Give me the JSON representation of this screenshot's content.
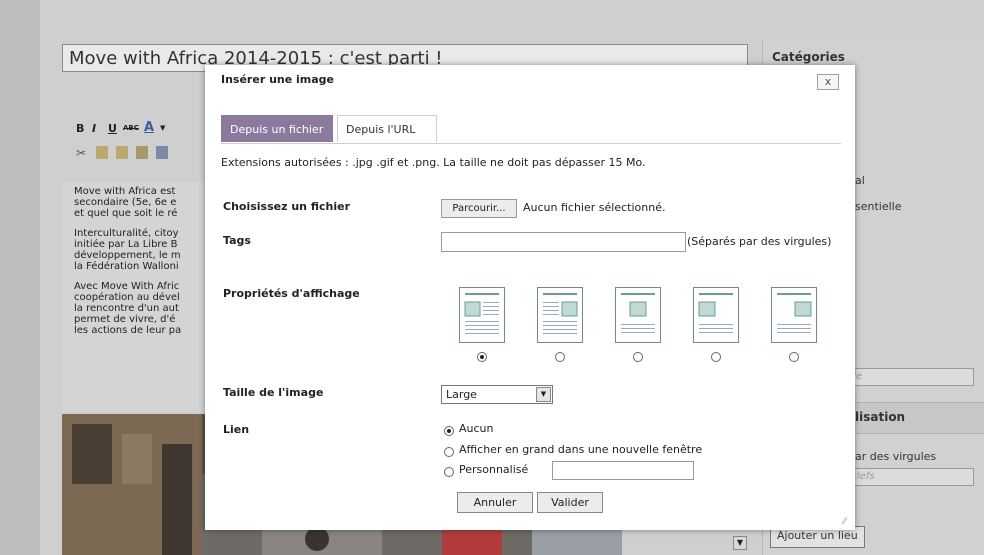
{
  "background": {
    "post_title": "Move with Africa 2014-2015 : c'est parti !",
    "toolbar": {
      "bold": "B",
      "italic": "I",
      "underline": "U",
      "strike": "ABC",
      "font_color": "A"
    },
    "editor_paragraphs": [
      [
        "Move with Africa est",
        "secondaire (5e, 6e e",
        "et quel que soit le ré"
      ],
      [
        "Interculturalité, citoy",
        "initiée par La Libre B",
        "développement, le m",
        "la Fédération Walloni"
      ],
      [
        "Avec Move With Afric",
        "coopération au dével",
        "la rencontre d'un aut",
        "permet de vivre, d'é",
        "les actions de leur pa"
      ]
    ],
    "sidebar": {
      "categories_title": "Catégories",
      "item_1": "al",
      "item_2": "sentielle",
      "new_category_placeholder": "orie",
      "section_2_title": "lisation",
      "tags_hint": "ar des virgules",
      "tags_placeholder": "s clefs",
      "add_place_button": "Ajouter un lieu"
    }
  },
  "dialog": {
    "title": "Insérer une image",
    "close_label": "x",
    "tabs": [
      {
        "label": "Depuis un fichier",
        "active": true
      },
      {
        "label": "Depuis l'URL",
        "active": false
      }
    ],
    "extensions_text": "Extensions autorisées : .jpg .gif et .png. La taille ne doit pas dépasser 15 Mo.",
    "file": {
      "label": "Choisissez un fichier",
      "browse_label": "Parcourir...",
      "status": "Aucun fichier sélectionné."
    },
    "tags": {
      "label": "Tags",
      "value": "",
      "hint": "(Séparés par des virgules)"
    },
    "display": {
      "label": "Propriétés d'affichage",
      "selected_index": 0,
      "options": [
        "left-text-wrap",
        "right-text-wrap",
        "center",
        "left",
        "right"
      ]
    },
    "size": {
      "label": "Taille de l'image",
      "selected": "Large"
    },
    "link": {
      "label": "Lien",
      "options": [
        "Aucun",
        "Afficher en grand dans une nouvelle fenêtre",
        "Personnalisé"
      ],
      "selected_index": 0,
      "custom_value": ""
    },
    "buttons": {
      "cancel": "Annuler",
      "submit": "Valider"
    }
  },
  "colors": {
    "active_tab": "#8c7a9e",
    "icon_accent": "#6f9b96"
  }
}
